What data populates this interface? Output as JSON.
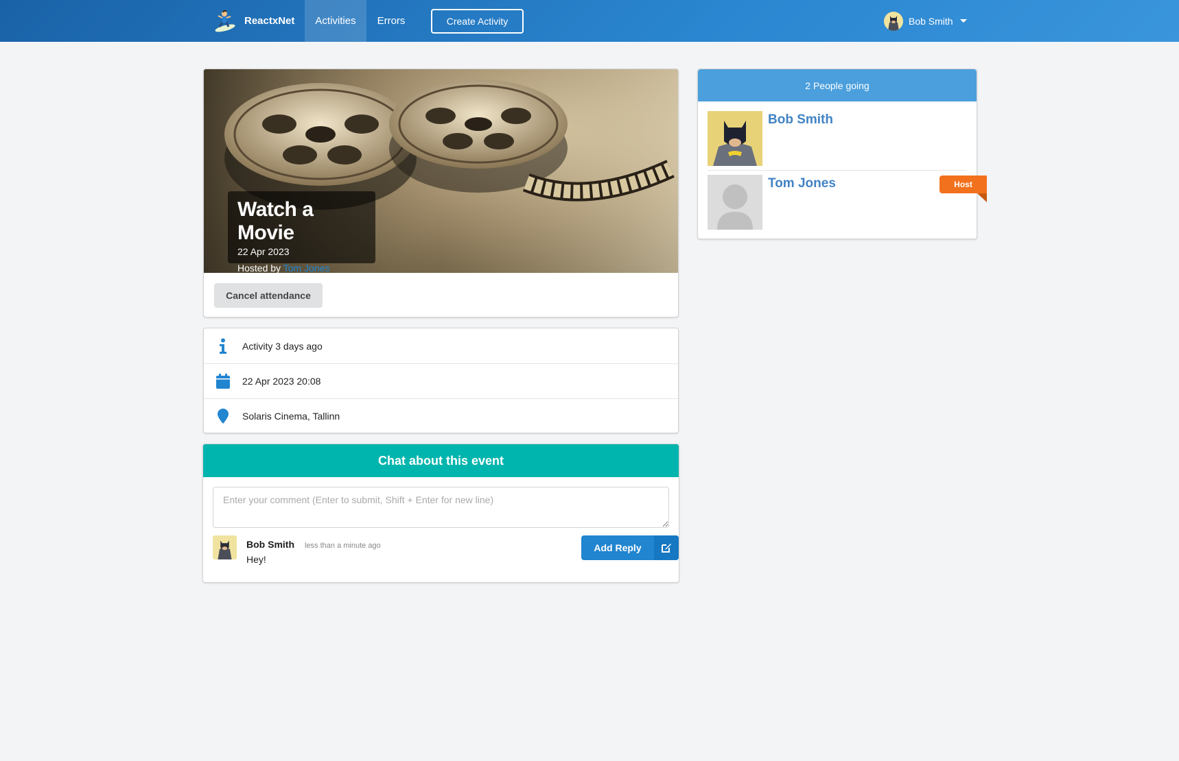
{
  "navbar": {
    "brand": "ReactxNet",
    "items": [
      {
        "label": "Activities"
      },
      {
        "label": "Errors"
      }
    ],
    "create_label": "Create Activity",
    "user_name": "Bob Smith"
  },
  "activity": {
    "title": "Watch a Movie",
    "date": "22 Apr 2023",
    "hosted_by_prefix": "Hosted by",
    "host_name": "Tom Jones",
    "cancel_label": "Cancel attendance"
  },
  "info": {
    "description": "Activity 3 days ago",
    "datetime": "22 Apr 2023 20:08",
    "venue": "Solaris Cinema, Tallinn"
  },
  "chat": {
    "header": "Chat about this event",
    "placeholder": "Enter your comment (Enter to submit, Shift + Enter for new line)",
    "reply_label": "Add Reply",
    "comments": [
      {
        "author": "Bob Smith",
        "time": "less than a minute ago",
        "body": "Hey!"
      }
    ]
  },
  "sidebar": {
    "header": "2 People going",
    "attendees": [
      {
        "name": "Bob Smith"
      },
      {
        "name": "Tom Jones",
        "badge": "Host"
      }
    ]
  },
  "colors": {
    "primary": "#2185d0",
    "teal": "#00b5ad",
    "host_orange": "#f2711c",
    "sidebar_header": "#4b9fdc"
  }
}
